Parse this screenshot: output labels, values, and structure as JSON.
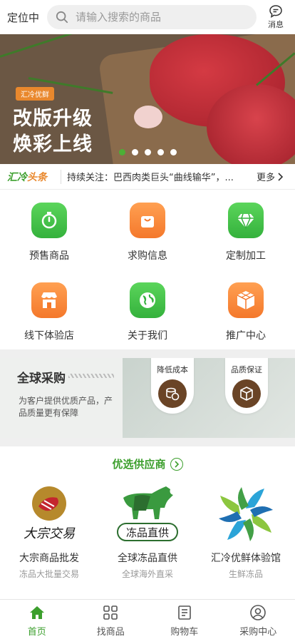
{
  "header": {
    "location": "定位中",
    "search_placeholder": "请输入搜索的商品",
    "message_label": "消息"
  },
  "banner": {
    "tag": "汇冷优鲜",
    "line1": "改版升级",
    "line2": "焕彩上线",
    "dot_count": 5,
    "active_dot": 0
  },
  "news": {
    "logo_part1": "汇冷",
    "logo_part2": "头条",
    "text": "持续关注：巴西肉类巨头“曲线输华”，...",
    "more": "更多"
  },
  "grid": [
    {
      "label": "预售商品",
      "icon": "stopwatch-icon",
      "color": "green"
    },
    {
      "label": "求购信息",
      "icon": "shopping-bag-icon",
      "color": "orange"
    },
    {
      "label": "定制加工",
      "icon": "diamond-icon",
      "color": "green"
    },
    {
      "label": "线下体验店",
      "icon": "storefront-icon",
      "color": "orange"
    },
    {
      "label": "关于我们",
      "icon": "globe-icon",
      "color": "green"
    },
    {
      "label": "推广中心",
      "icon": "cubes-icon",
      "color": "orange"
    }
  ],
  "procurement": {
    "title": "全球采购",
    "desc": "为客户提供优质产品，产品质量更有保障",
    "badge1": "降低成本",
    "badge2": "品质保证"
  },
  "suppliers": {
    "title": "优选供应商",
    "items": [
      {
        "name": "大宗商品批发",
        "sub": "冻品大批量交易",
        "logo_text": "大宗交易"
      },
      {
        "name": "全球冻品直供",
        "sub": "全球海外直采",
        "logo_text": "冻品直供"
      },
      {
        "name": "汇冷优鲜体验馆",
        "sub": "生鲜冻品",
        "logo_text": ""
      }
    ]
  },
  "tabbar": [
    {
      "label": "首页",
      "icon": "home-icon",
      "active": true
    },
    {
      "label": "找商品",
      "icon": "grid-icon",
      "active": false
    },
    {
      "label": "购物车",
      "icon": "cart-icon",
      "active": false
    },
    {
      "label": "采购中心",
      "icon": "user-icon",
      "active": false
    }
  ],
  "colors": {
    "accent_green": "#3c9f2d",
    "accent_orange": "#f4782b"
  }
}
